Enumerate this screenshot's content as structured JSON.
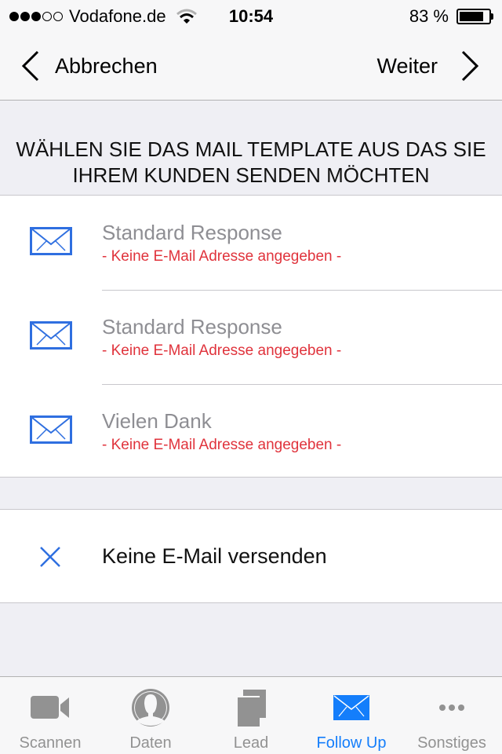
{
  "status_bar": {
    "signal_filled": 3,
    "signal_total": 5,
    "carrier": "Vodafone.de",
    "time": "10:54",
    "battery_text": "83 %",
    "battery_level": 0.83
  },
  "nav": {
    "back_label": "Abbrechen",
    "next_label": "Weiter"
  },
  "section": {
    "header": "WÄHLEN SIE DAS MAIL TEMPLATE AUS DAS SIE IHREM KUNDEN SENDEN MÖCHTEN"
  },
  "templates": [
    {
      "icon": "mail-icon",
      "title": "Standard Response",
      "subtitle": "- Keine E-Mail Adresse angegeben -"
    },
    {
      "icon": "mail-icon",
      "title": "Standard Response",
      "subtitle": "- Keine E-Mail Adresse angegeben -"
    },
    {
      "icon": "mail-icon",
      "title": "Vielen Dank",
      "subtitle": "- Keine E-Mail Adresse angegeben -"
    }
  ],
  "no_mail": {
    "icon": "close-icon",
    "label": "Keine E-Mail versenden"
  },
  "tabs": [
    {
      "icon": "video-camera-icon",
      "label": "Scannen",
      "active": false
    },
    {
      "icon": "person-icon",
      "label": "Daten",
      "active": false
    },
    {
      "icon": "documents-icon",
      "label": "Lead",
      "active": false
    },
    {
      "icon": "mail-icon",
      "label": "Follow Up",
      "active": true
    },
    {
      "icon": "more-icon",
      "label": "Sonstiges",
      "active": false
    }
  ],
  "colors": {
    "accent": "#147efb",
    "icon_blue": "#2f6fe0",
    "error_red": "#e0333c",
    "inactive_gray": "#929292"
  }
}
